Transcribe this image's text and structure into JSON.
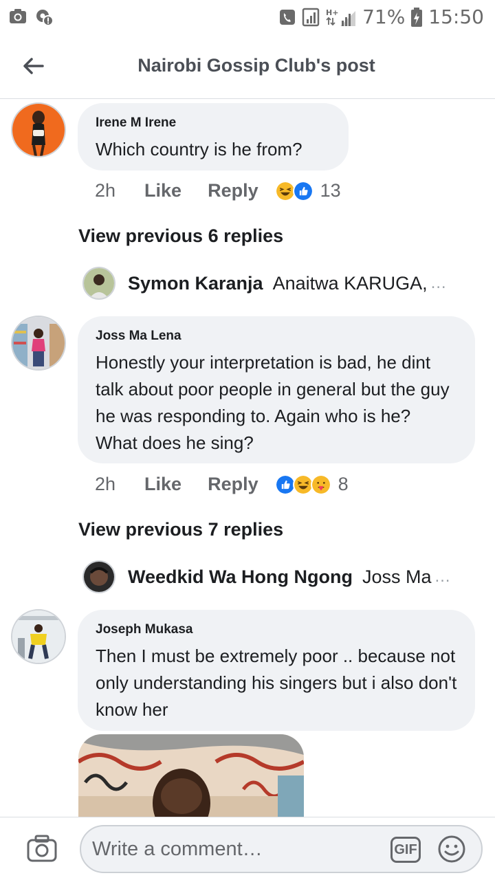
{
  "status_bar": {
    "battery_percent": "71%",
    "time": "15:50",
    "network": "H+"
  },
  "header": {
    "title": "Nairobi Gossip Club's post"
  },
  "comments": [
    {
      "author": "Irene M Irene",
      "text": "Which country is he from?",
      "time": "2h",
      "like_label": "Like",
      "reply_label": "Reply",
      "reactions": [
        "haha",
        "like"
      ],
      "reaction_count": "13",
      "view_previous": "View previous 6 replies",
      "latest_reply": {
        "author": "Symon Karanja",
        "snippet": "Anaitwa KARUGA,"
      }
    },
    {
      "author": "Joss Ma Lena",
      "text": "Honestly your interpretation is bad, he dint talk about poor people in general but the guy he was responding to. Again who is he? What does he sing?",
      "time": "2h",
      "like_label": "Like",
      "reply_label": "Reply",
      "reactions": [
        "like",
        "haha",
        "care"
      ],
      "reaction_count": "8",
      "view_previous": "View previous 7 replies",
      "latest_reply": {
        "author": "Weedkid Wa Hong Ngong",
        "snippet": "Joss Ma"
      }
    },
    {
      "author": "Joseph Mukasa",
      "text": "Then I must be extremely poor .. because not only understanding his singers but i also don't know her"
    }
  ],
  "composer": {
    "placeholder": "Write a comment…",
    "gif_label": "GIF"
  },
  "colors": {
    "bubble": "#f0f2f5",
    "secondary_text": "#65676b",
    "like_blue": "#1877f2",
    "haha_yellow": "#f7b928"
  }
}
